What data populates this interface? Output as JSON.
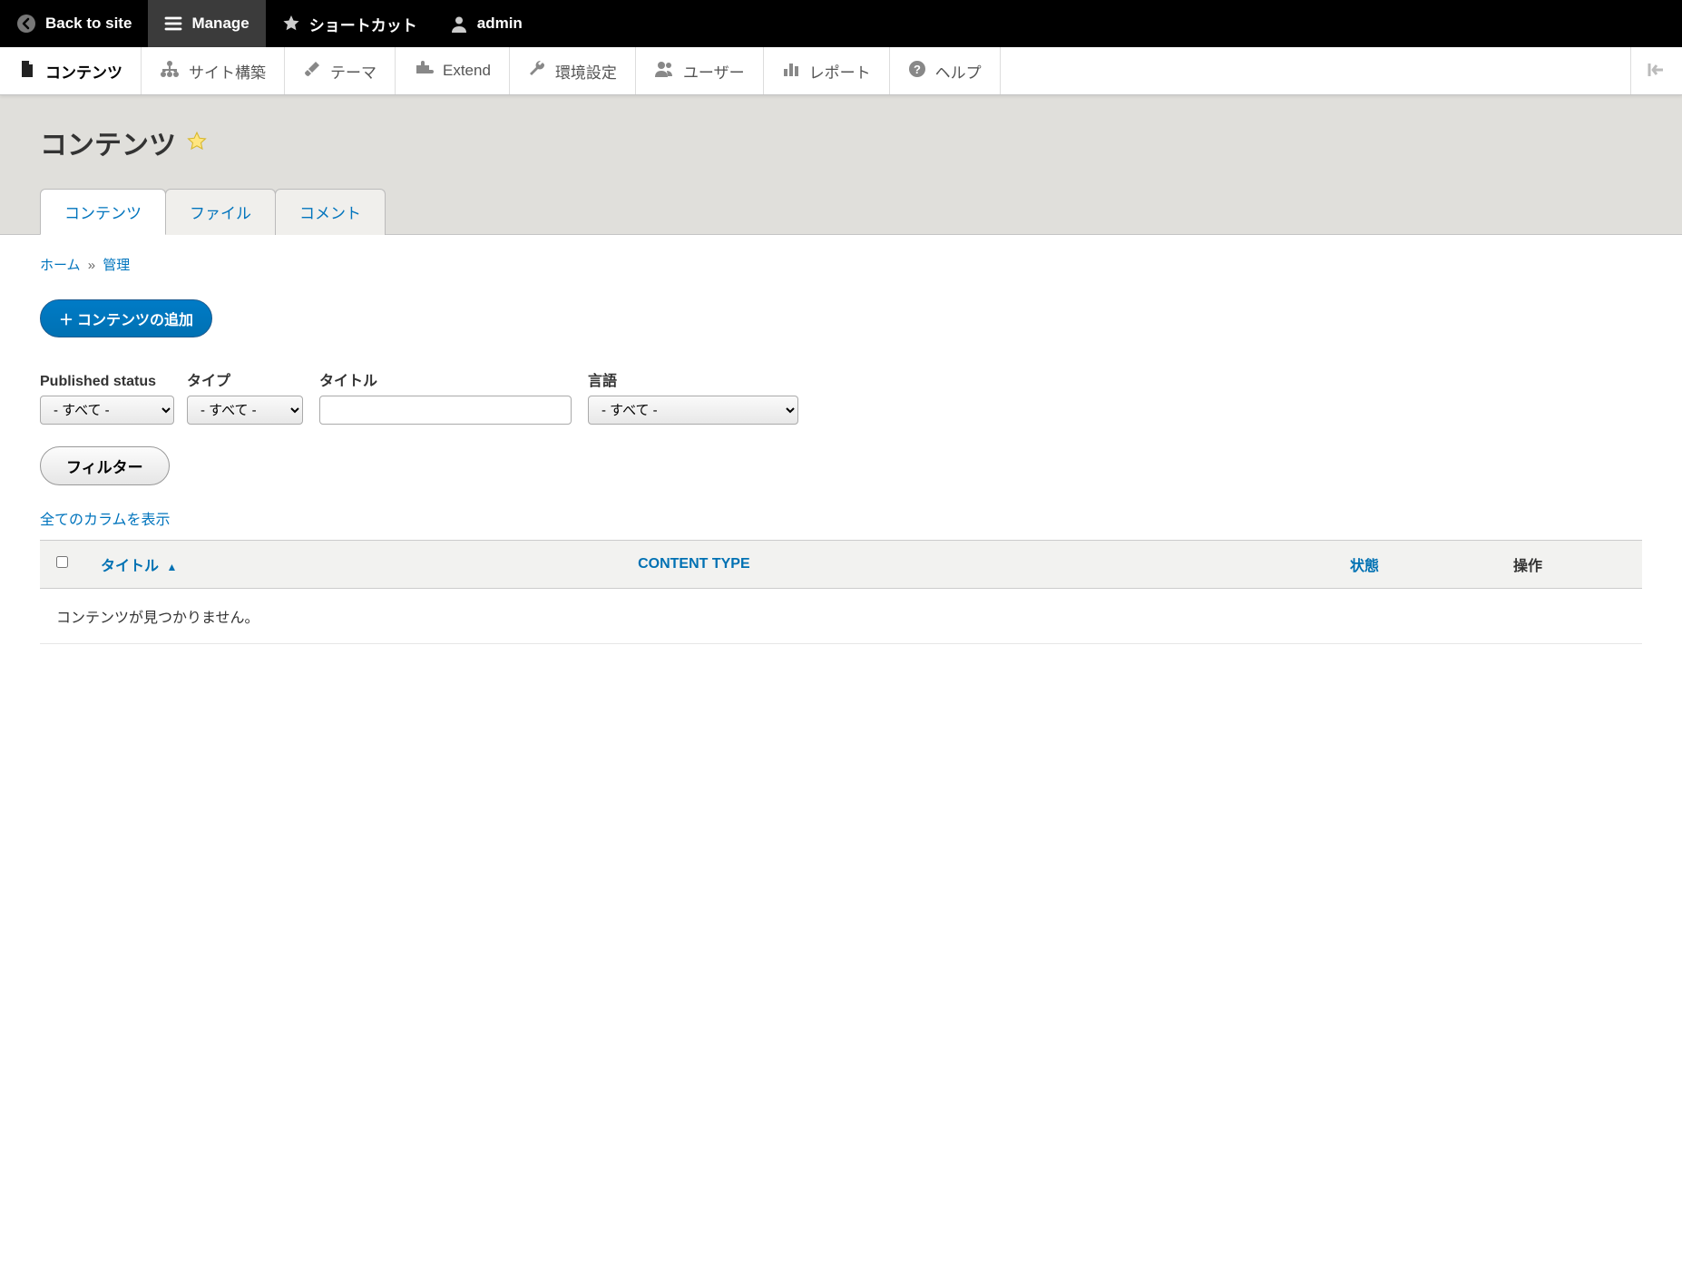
{
  "toolbar": {
    "back_label": "Back to site",
    "manage_label": "Manage",
    "shortcuts_label": "ショートカット",
    "user_label": "admin"
  },
  "admin_menu": {
    "items": [
      {
        "label": "コンテンツ",
        "icon": "file-icon",
        "active": true
      },
      {
        "label": "サイト構築",
        "icon": "structure-icon",
        "active": false
      },
      {
        "label": "テーマ",
        "icon": "brush-icon",
        "active": false
      },
      {
        "label": "Extend",
        "icon": "puzzle-icon",
        "active": false
      },
      {
        "label": "環境設定",
        "icon": "wrench-icon",
        "active": false
      },
      {
        "label": "ユーザー",
        "icon": "people-icon",
        "active": false
      },
      {
        "label": "レポート",
        "icon": "chart-icon",
        "active": false
      },
      {
        "label": "ヘルプ",
        "icon": "help-icon",
        "active": false
      }
    ]
  },
  "page": {
    "title": "コンテンツ"
  },
  "tabs": [
    {
      "label": "コンテンツ",
      "active": true
    },
    {
      "label": "ファイル",
      "active": false
    },
    {
      "label": "コメント",
      "active": false
    }
  ],
  "breadcrumb": {
    "home": "ホーム",
    "admin": "管理",
    "separator": "»"
  },
  "actions": {
    "add_content": "コンテンツの追加"
  },
  "filters": {
    "published": {
      "label": "Published status",
      "value": "- すべて -"
    },
    "type": {
      "label": "タイプ",
      "value": "- すべて -"
    },
    "title": {
      "label": "タイトル",
      "value": ""
    },
    "language": {
      "label": "言語",
      "value": "- すべて -"
    },
    "filter_button": "フィルター",
    "show_all_columns": "全てのカラムを表示"
  },
  "table": {
    "columns": {
      "title": "タイトル",
      "content_type": "CONTENT TYPE",
      "status": "状態",
      "operations": "操作"
    },
    "empty_message": "コンテンツが見つかりません。"
  }
}
